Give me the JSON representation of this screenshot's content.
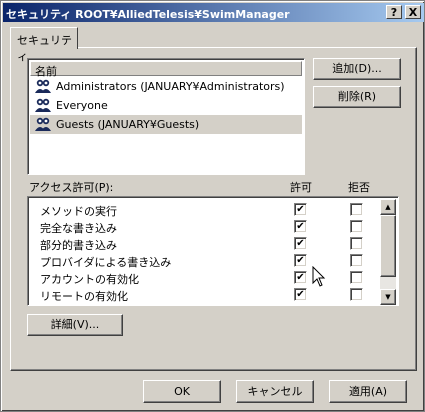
{
  "window": {
    "title": "セキュリティ ROOT¥AlliedTelesis¥SwimManager",
    "help_label": "?",
    "close_label": "X"
  },
  "tab": {
    "label": "セキュリティ"
  },
  "users": {
    "column_header": "名前",
    "items": [
      {
        "name": "Administrators (JANUARY¥Administrators)",
        "icon": "user-group-icon",
        "selected": false
      },
      {
        "name": "Everyone",
        "icon": "user-group-icon",
        "selected": false
      },
      {
        "name": "Guests (JANUARY¥Guests)",
        "icon": "user-group-icon",
        "selected": true
      }
    ],
    "add_label": "追加(D)...",
    "remove_label": "削除(R)"
  },
  "permissions": {
    "label": "アクセス許可(P):",
    "allow_header": "許可",
    "deny_header": "拒否",
    "items": [
      {
        "name": "メソッドの実行",
        "allow": true,
        "deny": false
      },
      {
        "name": "完全な書き込み",
        "allow": true,
        "deny": false
      },
      {
        "name": "部分的書き込み",
        "allow": true,
        "deny": false
      },
      {
        "name": "プロバイダによる書き込み",
        "allow": true,
        "deny": false
      },
      {
        "name": "アカウントの有効化",
        "allow": true,
        "deny": false
      },
      {
        "name": "リモートの有効化",
        "allow": true,
        "deny": false
      }
    ],
    "advanced_label": "詳細(V)..."
  },
  "footer": {
    "ok_label": "OK",
    "cancel_label": "キャンセル",
    "apply_label": "適用(A)"
  },
  "colors": {
    "title_start": "#0a246a",
    "title_end": "#a6caf0",
    "face": "#d4d0c8"
  }
}
